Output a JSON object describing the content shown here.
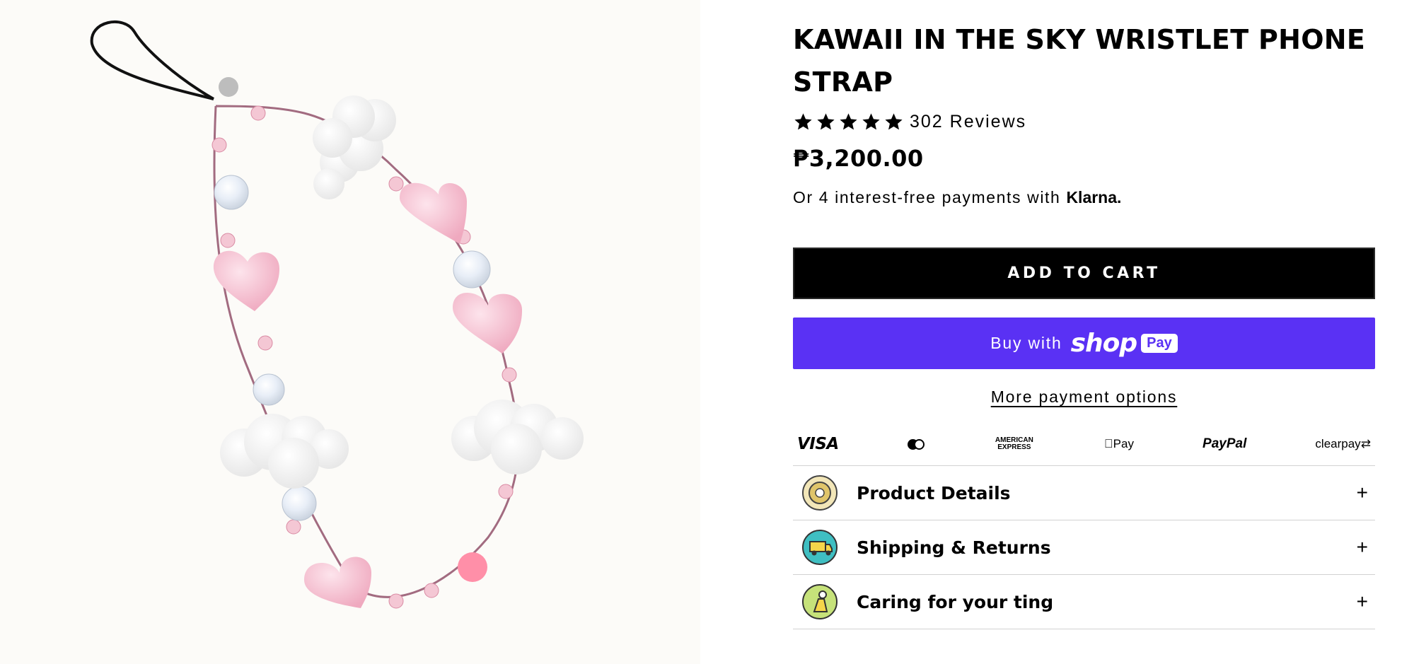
{
  "product": {
    "title": "KAWAII IN THE SKY WRISTLET PHONE STRAP",
    "rating_stars": 5,
    "reviews_label": "302 Reviews",
    "price": "₱3,200.00",
    "installments_text": "Or 4 interest-free payments with",
    "installments_brand": "Klarna."
  },
  "buttons": {
    "add_to_cart": "ADD TO CART",
    "buy_with": "Buy with",
    "shop": "shop",
    "pay": "Pay",
    "more_payment_options": "More payment options"
  },
  "payment_methods": [
    {
      "name": "visa",
      "label": "VISA"
    },
    {
      "name": "mastercard",
      "label": ""
    },
    {
      "name": "amex",
      "label": "AMERICAN EXPRESS"
    },
    {
      "name": "applepay",
      "label": "Pay"
    },
    {
      "name": "paypal",
      "label": "PayPal"
    },
    {
      "name": "clearpay",
      "label": "clearpay"
    }
  ],
  "accordion": [
    {
      "label": "Product Details",
      "icon": "badge-icon",
      "color": "#e8d48a"
    },
    {
      "label": "Shipping & Returns",
      "icon": "delivery-truck-icon",
      "color": "#3fbfc2"
    },
    {
      "label": "Caring for your ting",
      "icon": "care-icon",
      "color": "#9ccc3a"
    }
  ],
  "colors": {
    "shoppay": "#5a31f4",
    "gallery_bg": "#fcfbf8",
    "bead_pink": "#f7c6d3",
    "cloud_white": "#ffffff"
  }
}
